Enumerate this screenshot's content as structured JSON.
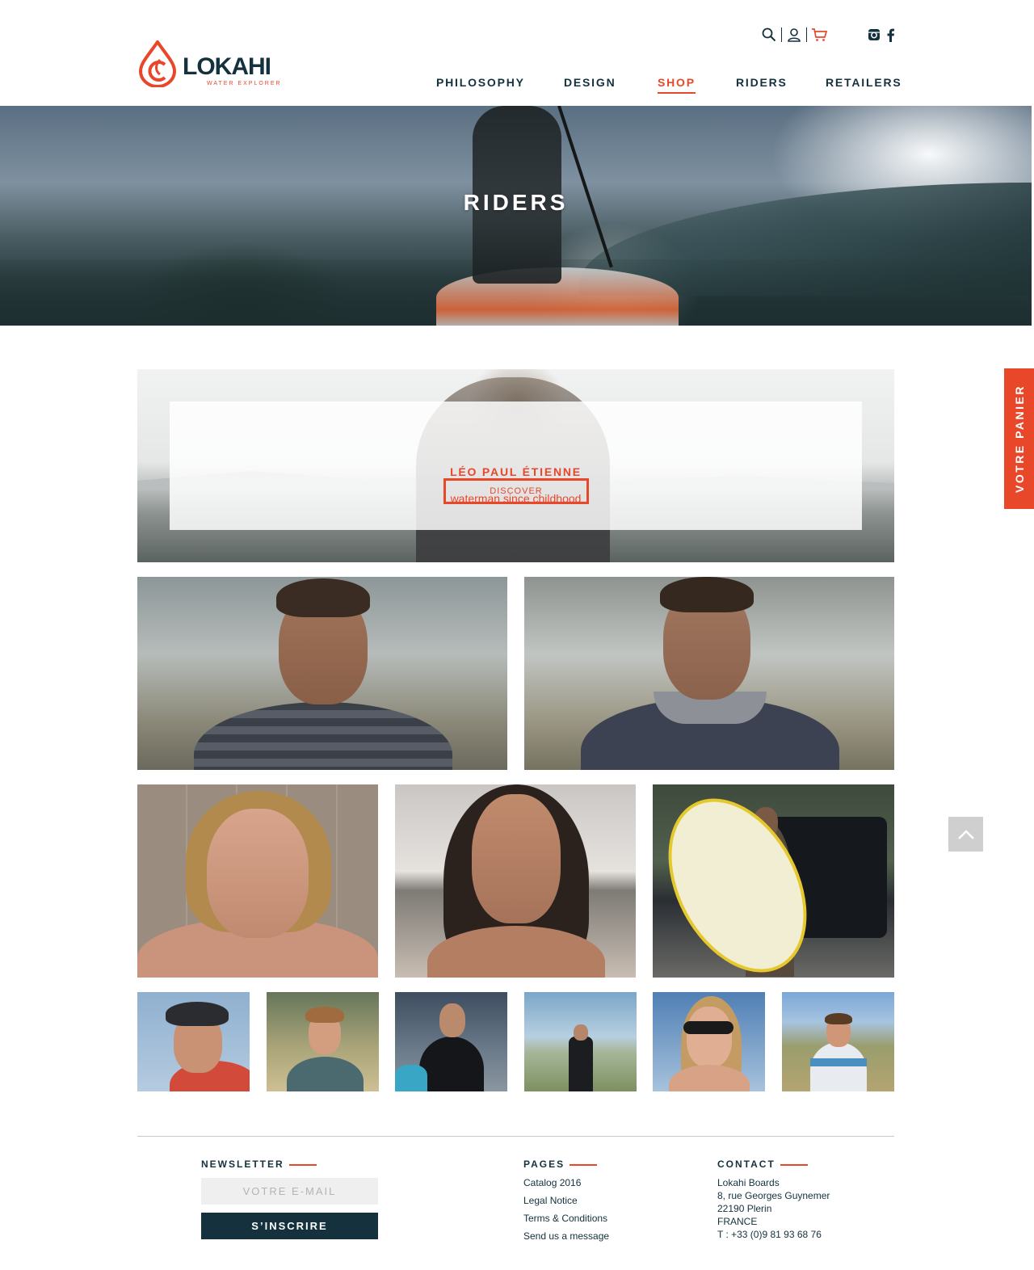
{
  "brand": {
    "name": "LOKAHI",
    "tagline": "WATER EXPLORER",
    "accent_color": "#e8472a",
    "dark_color": "#14313d"
  },
  "utility_icons": [
    "search-icon",
    "user-icon",
    "cart-icon",
    "instagram-icon",
    "facebook-icon"
  ],
  "nav": {
    "items": [
      {
        "label": "PHILOSOPHY"
      },
      {
        "label": "DESIGN"
      },
      {
        "label": "SHOP",
        "active": true
      },
      {
        "label": "RIDERS"
      },
      {
        "label": "RETAILERS"
      }
    ]
  },
  "hero": {
    "title": "RIDERS"
  },
  "side_tab": {
    "label": "VOTRE PANIER"
  },
  "feature": {
    "name": "LÉO PAUL ÉTIENNE",
    "subtitle": "waterman since childhood",
    "button_label": "DISCOVER"
  },
  "footer": {
    "newsletter": {
      "title": "NEWSLETTER",
      "input_placeholder": "VOTRE E-MAIL",
      "button_label": "S’INSCRIRE"
    },
    "pages": {
      "title": "PAGES",
      "links": [
        "Catalog 2016",
        "Legal Notice",
        "Terms & Conditions",
        "Send us a message"
      ]
    },
    "contact": {
      "title": "CONTACT",
      "lines": [
        "Lokahi Boards",
        "8, rue Georges Guynemer",
        "22190 Plerin",
        "FRANCE",
        "T : +33 (0)9 81 93 68 76"
      ]
    }
  }
}
